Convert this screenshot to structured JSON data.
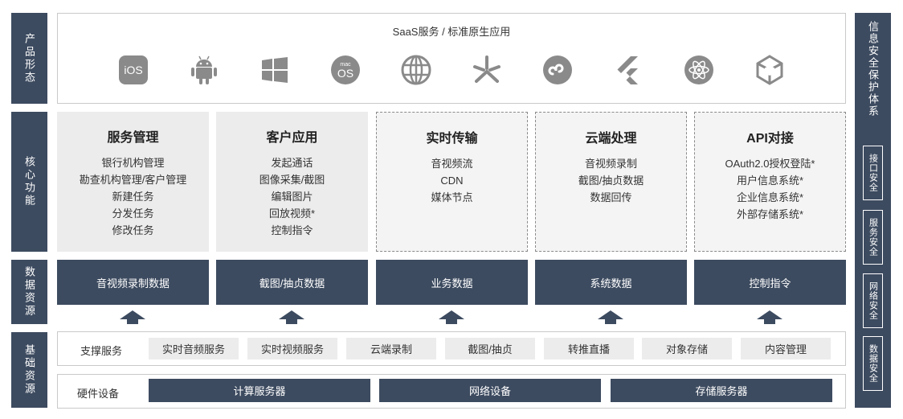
{
  "left_labels": [
    "产品形态",
    "核心功能",
    "数据资源",
    "基础资源"
  ],
  "right_column": {
    "title": "信息安全保护体系",
    "items": [
      "接口安全",
      "服务安全",
      "网络安全",
      "数据安全"
    ]
  },
  "product": {
    "title": "SaaS服务 / 标准原生应用",
    "icons": [
      "ios-icon",
      "android-icon",
      "windows-icon",
      "macos-icon",
      "web-globe-icon",
      "asterisk-app-icon",
      "mini-program-icon",
      "flutter-icon",
      "electron-icon",
      "unity-icon"
    ],
    "icon_texts": {
      "ios": "iOS",
      "mac_top": "mac",
      "mac_os": "OS"
    }
  },
  "core": [
    {
      "title": "服务管理",
      "items": [
        "银行机构管理",
        "勘查机构管理/客户管理",
        "新建任务",
        "分发任务",
        "修改任务"
      ]
    },
    {
      "title": "客户应用",
      "items": [
        "发起通话",
        "图像采集/截图",
        "编辑图片",
        "回放视频*",
        "控制指令"
      ]
    },
    {
      "title": "实时传输",
      "items": [
        "音视频流",
        "CDN",
        "媒体节点"
      ]
    },
    {
      "title": "云端处理",
      "items": [
        "音视频录制",
        "截图/抽贞数据",
        "数据回传"
      ]
    },
    {
      "title": "API对接",
      "items": [
        "OAuth2.0授权登陆*",
        "用户信息系统*",
        "企业信息系统*",
        "外部存储系统*"
      ]
    }
  ],
  "data_resources": [
    "音视频录制数据",
    "截图/抽贞数据",
    "业务数据",
    "系统数据",
    "控制指令"
  ],
  "support": {
    "label": "支撑服务",
    "items": [
      "实时音频服务",
      "实时视频服务",
      "云端录制",
      "截图/抽贞",
      "转推直播",
      "对象存储",
      "内容管理"
    ]
  },
  "hardware": {
    "label": "硬件设备",
    "items": [
      "计算服务器",
      "网络设备",
      "存储服务器"
    ]
  },
  "colors": {
    "dark": "#3d4b60",
    "light_box": "#ececec",
    "icon_gray": "#8a8a8a"
  }
}
